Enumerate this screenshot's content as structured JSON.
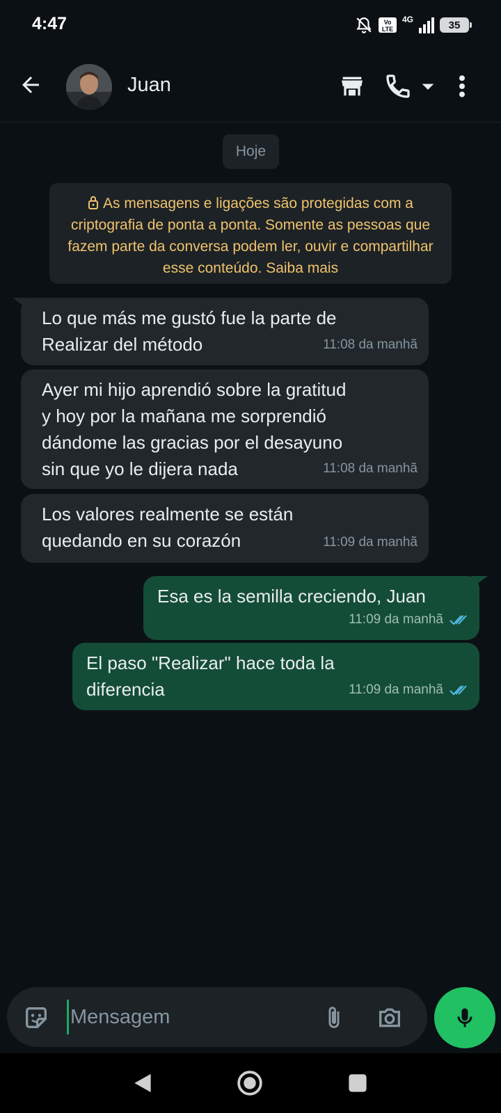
{
  "status_bar": {
    "time": "4:47",
    "volte": "Vo LTE",
    "network": "4G",
    "battery": "35"
  },
  "header": {
    "contact_name": "Juan",
    "icons": [
      "back-arrow-icon",
      "store-icon",
      "phone-icon",
      "dropdown-icon",
      "more-vert-icon"
    ]
  },
  "chat": {
    "date_chip": "Hoje",
    "encryption_notice": "As mensagens e ligações são protegidas com a criptografia de ponta a ponta. Somente as pessoas que fazem parte da conversa podem ler, ouvir e compartilhar esse conteúdo. Saiba mais",
    "messages": [
      {
        "direction": "in",
        "text": "Lo que más me gustó fue la parte de\nRealizar del método",
        "time": "11:08 da manhã"
      },
      {
        "direction": "in",
        "text": "Ayer mi hijo aprendió sobre la gratitud\ny hoy por la mañana me sorprendió\ndándome las gracias por el desayuno\nsin que yo le dijera nada",
        "time": "11:08 da manhã"
      },
      {
        "direction": "in",
        "text": "Los valores realmente se están\nquedando en su corazón",
        "time": "11:09 da manhã"
      },
      {
        "direction": "out",
        "text": "Esa es la semilla creciendo, Juan",
        "time": "11:09 da manhã",
        "status": "read"
      },
      {
        "direction": "out",
        "text": "El paso \"Realizar\" hace toda la\ndiferencia",
        "time": "11:09 da manhã",
        "status": "read"
      }
    ]
  },
  "composer": {
    "placeholder": "Mensagem",
    "icons": [
      "sticker-icon",
      "attach-icon",
      "camera-icon",
      "mic-icon"
    ]
  },
  "colors": {
    "background": "#0b1014",
    "incoming_bubble": "#22272b",
    "outgoing_bubble": "#144d37",
    "accent_green": "#21c063",
    "encryption_text": "#f0c36d",
    "read_ticks": "#53bdeb"
  }
}
